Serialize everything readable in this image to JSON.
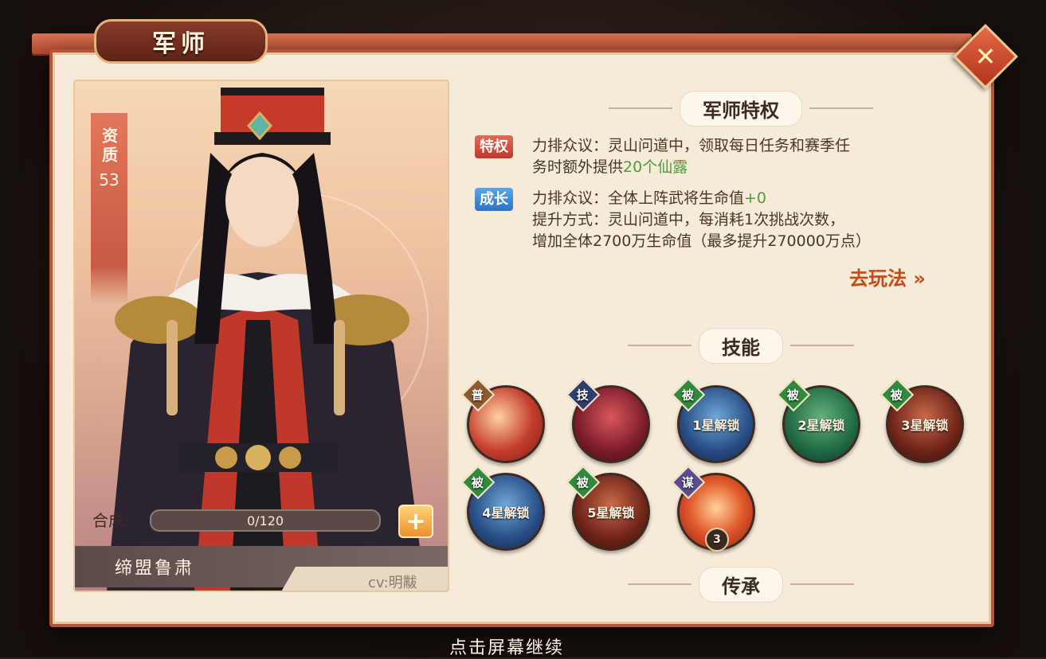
{
  "window": {
    "title": "军师",
    "close_icon": "close-icon"
  },
  "portrait": {
    "aptitude_label": "资质",
    "aptitude_value": "53",
    "synth_label": "合成:",
    "synth_progress": "0/120",
    "synth_plus": "+",
    "hero_name": "缔盟鲁肃",
    "cv": "cv:明黻"
  },
  "privilege": {
    "section_title": "军师特权",
    "special_badge": "特权",
    "special_text_1": "力排众议：灵山问道中，领取每日任务和赛季任",
    "special_text_2": "务时额外提供",
    "special_highlight": "20个仙露",
    "growth_badge": "成长",
    "growth_text_1": "力排众议：全体上阵武将生命值",
    "growth_highlight": "+0",
    "growth_text_2": "提升方式：灵山问道中，每消耗1次挑战次数，",
    "growth_text_3": "增加全体2700万生命值（最多提升270000万点）",
    "goto_label": "去玩法"
  },
  "skills": {
    "section_title": "技能",
    "items": [
      {
        "tag": "普",
        "label": ""
      },
      {
        "tag": "技",
        "label": ""
      },
      {
        "tag": "被",
        "label": "1星解锁"
      },
      {
        "tag": "被",
        "label": "2星解锁"
      },
      {
        "tag": "被",
        "label": "3星解锁"
      },
      {
        "tag": "被",
        "label": "4星解锁"
      },
      {
        "tag": "被",
        "label": "5星解锁"
      },
      {
        "tag": "谋",
        "label": "",
        "level": "3"
      }
    ]
  },
  "inherit": {
    "section_title": "传承"
  },
  "footer": {
    "continue_text": "点击屏幕继续"
  },
  "colors": {
    "accent": "#b5533b",
    "panel": "#f6ead8",
    "highlight_green": "#4d9b3a"
  }
}
